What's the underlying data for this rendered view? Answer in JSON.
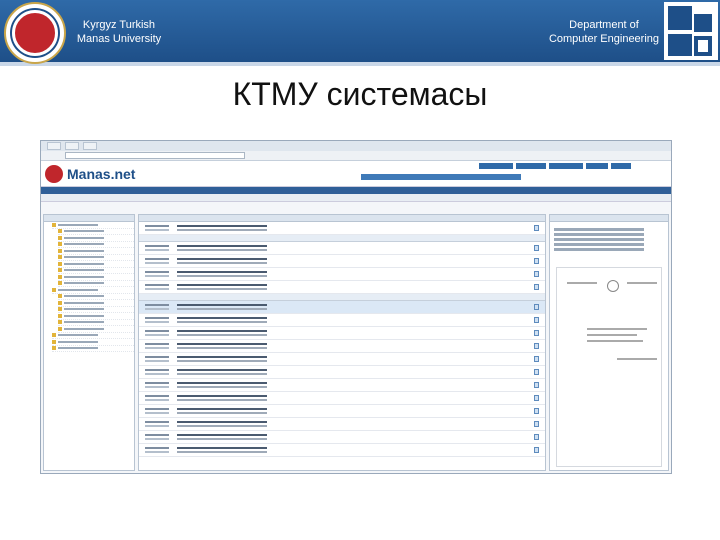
{
  "banner": {
    "university": "Kyrgyz Turkish Manas University",
    "department": "Department of Computer Engineering"
  },
  "title": "КТМУ системасы",
  "screenshot": {
    "brand": "Manas.net",
    "icons": [
      "university-seal-icon",
      "department-logo-icon",
      "manas-logo-icon",
      "document-icon",
      "folder-icon"
    ]
  }
}
